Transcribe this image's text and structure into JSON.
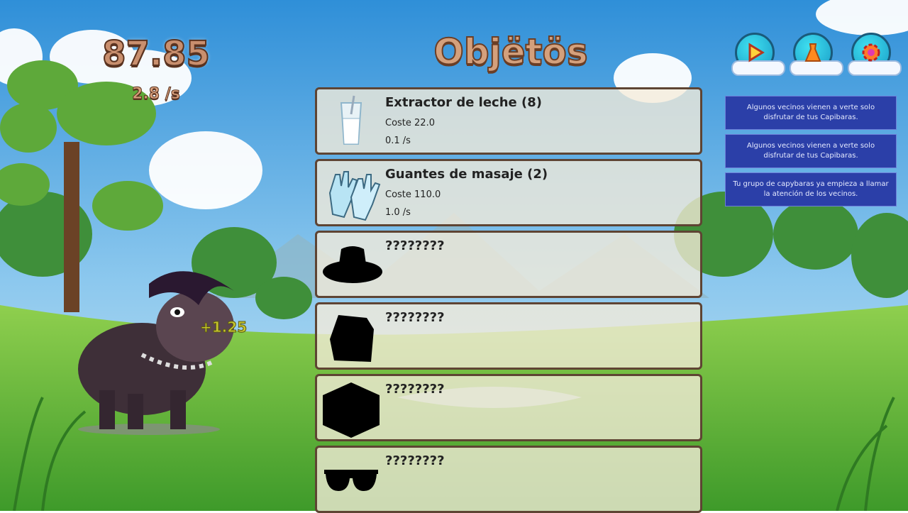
{
  "hud": {
    "score": "87.85",
    "rate": "2.8 /s",
    "floating_bonus": "+1.25"
  },
  "panel": {
    "title": "Objëtös"
  },
  "buttons": {
    "play": {
      "icon": "play-icon"
    },
    "outfit": {
      "icon": "dress-icon"
    },
    "settings": {
      "icon": "gear-icon"
    }
  },
  "notifications": [
    "Algunos vecinos vienen a verte solo disfrutar de tus Capibaras.",
    "Algunos vecinos vienen a verte solo disfrutar de tus Capibaras.",
    "Tu grupo de capybaras ya empieza a llamar la atención de los vecinos."
  ],
  "items": [
    {
      "name": "Extractor de leche (8)",
      "cost": "Coste 22.0",
      "production": "0.1 /s",
      "icon": "milk-glass-icon",
      "locked": false
    },
    {
      "name": "Guantes de masaje (2)",
      "cost": "Coste 110.0",
      "production": "1.0 /s",
      "icon": "gloves-icon",
      "locked": false
    },
    {
      "name": "????????",
      "cost": "",
      "production": "",
      "icon": "hat-silhouette-icon",
      "locked": true
    },
    {
      "name": "????????",
      "cost": "",
      "production": "",
      "icon": "bag-silhouette-icon",
      "locked": true
    },
    {
      "name": "????????",
      "cost": "",
      "production": "",
      "icon": "box-silhouette-icon",
      "locked": true
    },
    {
      "name": "????????",
      "cost": "",
      "production": "",
      "icon": "sunglasses-silhouette-icon",
      "locked": true
    }
  ],
  "colors": {
    "sky": "#4aa6e0",
    "grass": "#5fb23a",
    "panel_border": "#5e4433",
    "notice_bg": "#2b3fa8"
  }
}
